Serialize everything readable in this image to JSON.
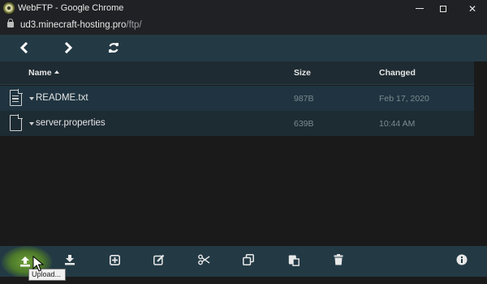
{
  "window": {
    "title": "WebFTP - Google Chrome",
    "url_host": "ud3.minecraft-hosting.pro",
    "url_path": "/ftp/"
  },
  "navbar": {
    "back_icon": "chevron-left-icon",
    "forward_icon": "chevron-right-icon",
    "refresh_icon": "refresh-icon"
  },
  "table": {
    "headers": {
      "name": "Name",
      "size": "Size",
      "changed": "Changed"
    },
    "rows": [
      {
        "name": "README.txt",
        "size": "987B",
        "changed": "Feb 17, 2020",
        "icon": "text-file-icon"
      },
      {
        "name": "server.properties",
        "size": "639B",
        "changed": "10:44 AM",
        "icon": "file-icon"
      }
    ]
  },
  "toolbar": {
    "upload_tooltip": "Upload...",
    "icons": [
      "upload-icon",
      "download-icon",
      "new-folder-icon",
      "edit-icon",
      "cut-icon",
      "copy-icon",
      "paste-icon",
      "delete-icon",
      "info-icon"
    ]
  },
  "colors": {
    "toolbar_bg": "#233a45",
    "selected_row": "#1f3440",
    "upload_highlight": "#6ea03a"
  }
}
